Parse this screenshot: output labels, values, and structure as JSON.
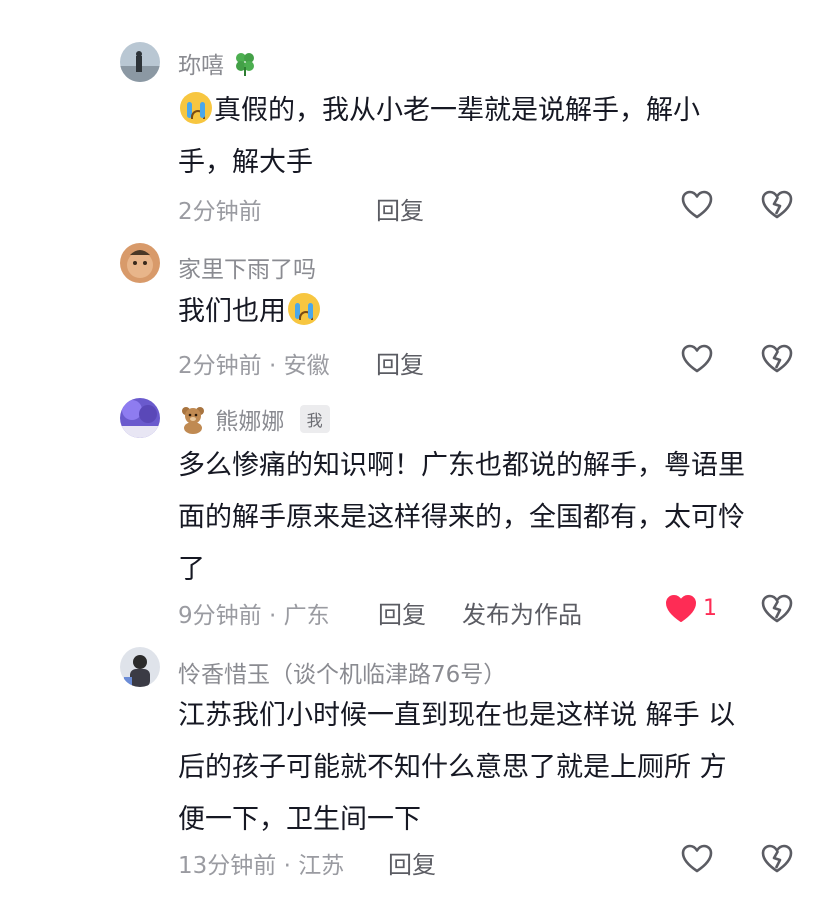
{
  "comments": [
    {
      "username": "珎嘻",
      "username_suffix_icon": "four-leaf-clover-icon",
      "text_parts": [
        "真假的，我从小老一辈就是说解手，解小",
        "手，解大手"
      ],
      "leading_emoji": "loudly-crying-face",
      "time": "2分钟前",
      "location": "",
      "reply_label": "回复"
    },
    {
      "username": "家里下雨了吗",
      "text": "我们也用",
      "trailing_emoji": "loudly-crying-face",
      "time": "2分钟前 · 安徽",
      "reply_label": "回复"
    },
    {
      "username": "熊娜娜",
      "username_prefix_icon": "teddy-bear-icon",
      "me_tag": "我",
      "text_lines": [
        "多么惨痛的知识啊！广东也都说的解手，粤语里",
        "面的解手原来是这样得来的，全国都有，太可怜",
        "了"
      ],
      "time": "9分钟前 · 广东",
      "reply_label": "回复",
      "publish_label": "发布为作品",
      "like_count": "1",
      "liked": true
    },
    {
      "username": "怜香惜玉（谈个机临津路76号）",
      "text_lines": [
        "江苏我们小时候一直到现在也是这样说 解手 以",
        "后的孩子可能就不知什么意思了就是上厕所 方",
        "便一下，卫生间一下"
      ],
      "time": "13分钟前 · 江苏",
      "reply_label": "回复"
    }
  ],
  "colors": {
    "like_red": "#fe2c55",
    "meta_gray": "#9a9ba1",
    "text_dark": "#161823"
  }
}
